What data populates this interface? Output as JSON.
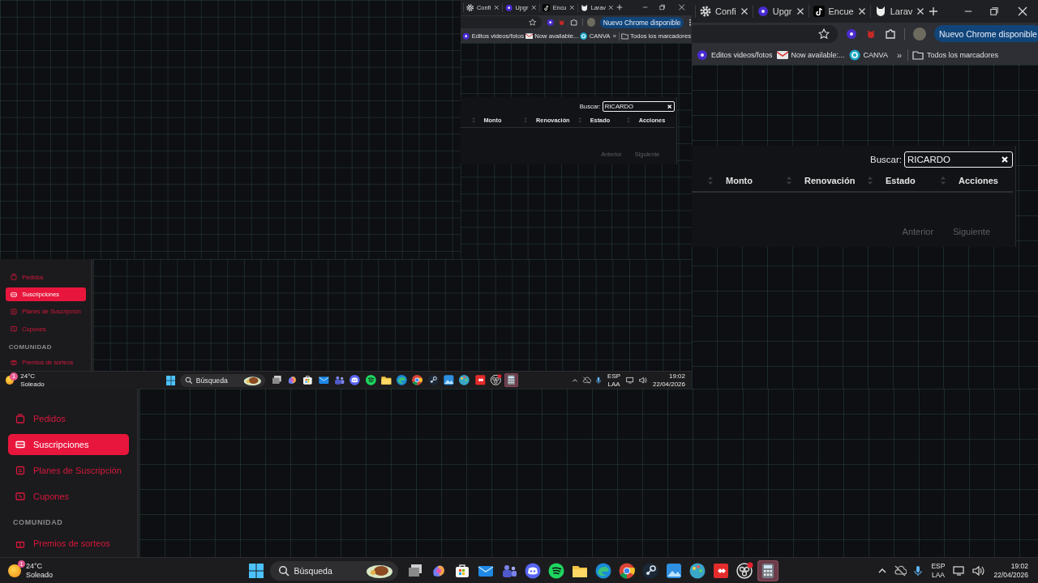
{
  "screen": {
    "screenshot": {
      "browser": {
        "tabs": [
          {
            "label": "Confi",
            "kind": "gear"
          },
          {
            "label": "Upgr",
            "kind": "orb"
          },
          {
            "label": "Encu",
            "kind": "note"
          },
          {
            "label": "Larav",
            "kind": "cat"
          }
        ],
        "update_button": "Nuevo Chrome disponible",
        "bookmarks": [
          {
            "label": "Editos videos/fotos",
            "kind": "orb"
          },
          {
            "label": "Now available...",
            "kind": "mail"
          },
          {
            "label": "CANVA",
            "kind": "canva"
          }
        ],
        "bookmarks_overflow": "»",
        "all_bookmarks": "Todos los marcadores"
      },
      "table": {
        "search_label": "Buscar:",
        "search_value": "RICARDO",
        "columns": [
          "Monto",
          "Renovación",
          "Estado",
          "Acciones"
        ],
        "pager": [
          "Anterior",
          "Siguiente"
        ]
      },
      "sidebar": {
        "items": [
          {
            "label": "Pedidos",
            "kind": "box",
            "selected": false
          },
          {
            "label": "Suscripciones",
            "kind": "ticket",
            "selected": true
          },
          {
            "label": "Planes de Suscripción",
            "kind": "card",
            "selected": false
          },
          {
            "label": "Cupones",
            "kind": "tag",
            "selected": false
          }
        ],
        "section": "COMUNIDAD",
        "section_items": [
          {
            "label": "Premios de sorteos",
            "kind": "gift",
            "selected": false
          }
        ]
      },
      "taskbar": {
        "temperature": "24°C",
        "weather": "Soleado",
        "weather_badge": "1",
        "search_placeholder": "Búsqueda",
        "apps": [
          {
            "kind": "files",
            "selected": false
          },
          {
            "kind": "copilot",
            "selected": false
          },
          {
            "kind": "store",
            "selected": false
          },
          {
            "kind": "mail",
            "selected": false
          },
          {
            "kind": "teams",
            "selected": false
          },
          {
            "kind": "discord",
            "selected": false
          },
          {
            "kind": "spotify",
            "selected": false
          },
          {
            "kind": "explorer",
            "selected": false
          },
          {
            "kind": "edge",
            "selected": false
          },
          {
            "kind": "chrome",
            "selected": false
          },
          {
            "kind": "steam",
            "selected": false
          },
          {
            "kind": "photos",
            "selected": false
          },
          {
            "kind": "paint",
            "selected": false
          },
          {
            "kind": "anydesk",
            "selected": false
          },
          {
            "kind": "obs",
            "selected": false
          },
          {
            "kind": "calculator",
            "selected": true
          }
        ],
        "language": "ESP",
        "layout": "LAA",
        "time": "19:02",
        "date": "22/04/2026"
      }
    },
    "browser": {
      "tabs": [
        {
          "label": "Confi",
          "kind": "gear"
        },
        {
          "label": "Upgr",
          "kind": "orb"
        },
        {
          "label": "Encue",
          "kind": "note"
        },
        {
          "label": "Larav",
          "kind": "cat"
        }
      ],
      "update_button": "Nuevo Chrome disponible",
      "bookmarks": [
        {
          "label": "Editos videos/fotos",
          "kind": "orb"
        },
        {
          "label": "Now available:...",
          "kind": "mail"
        },
        {
          "label": "CANVA",
          "kind": "canva"
        }
      ],
      "bookmarks_overflow": "»",
      "all_bookmarks": "Todos los marcadores"
    },
    "table": {
      "search_label": "Buscar:",
      "search_value": "RICARDO",
      "columns": [
        "Monto",
        "Renovación",
        "Estado",
        "Acciones"
      ],
      "pager": [
        "Anterior",
        "Siguiente"
      ]
    },
    "sidebar": {
      "items": [
        {
          "label": "Pedidos",
          "kind": "box",
          "selected": false
        },
        {
          "label": "Suscripciones",
          "kind": "ticket",
          "selected": true
        },
        {
          "label": "Planes de Suscripción",
          "kind": "card",
          "selected": false
        },
        {
          "label": "Cupones",
          "kind": "tag",
          "selected": false
        }
      ],
      "section": "COMUNIDAD",
      "section_items": [
        {
          "label": "Premios de sorteos",
          "kind": "gift",
          "selected": false
        }
      ]
    },
    "taskbar": {
      "temperature": "24°C",
      "weather": "Soleado",
      "weather_badge": "1",
      "search_placeholder": "Búsqueda",
      "apps": [
        {
          "kind": "files",
          "selected": false
        },
        {
          "kind": "copilot",
          "selected": false
        },
        {
          "kind": "store",
          "selected": false
        },
        {
          "kind": "mail",
          "selected": false
        },
        {
          "kind": "teams",
          "selected": false
        },
        {
          "kind": "discord",
          "selected": false
        },
        {
          "kind": "spotify",
          "selected": false
        },
        {
          "kind": "explorer",
          "selected": false
        },
        {
          "kind": "edge",
          "selected": false
        },
        {
          "kind": "chrome",
          "selected": false
        },
        {
          "kind": "steam",
          "selected": false
        },
        {
          "kind": "photos",
          "selected": false
        },
        {
          "kind": "paint",
          "selected": false
        },
        {
          "kind": "anydesk",
          "selected": false
        },
        {
          "kind": "obs",
          "selected": false
        },
        {
          "kind": "calculator",
          "selected": true
        }
      ],
      "language": "ESP",
      "layout": "LAA",
      "time": "19:02",
      "date": "22/04/2026"
    }
  }
}
